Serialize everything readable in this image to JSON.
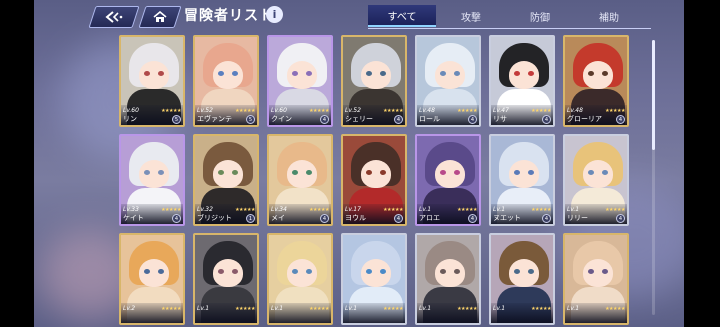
{
  "header": {
    "title": "冒険者リスト",
    "info_label": "i",
    "back_icon": "back-arrow-icon",
    "home_icon": "home-icon"
  },
  "tabs": [
    {
      "label": "すべて",
      "active": true
    },
    {
      "label": "攻撃",
      "active": false
    },
    {
      "label": "防御",
      "active": false
    },
    {
      "label": "補助",
      "active": false
    }
  ],
  "colors": {
    "gold_frame": "#d8b66a",
    "silver_frame": "#c9cedf",
    "purple_frame": "#b996e8",
    "tab_active": "#1c225a",
    "star": "#ffd66b"
  },
  "rows": [
    [
      {
        "level": "Lv.60",
        "name": "リン",
        "stars": "★★★★★",
        "rank": "5",
        "frame": "gold",
        "hair": "#e8e6ea",
        "bg": "#c9c4b8",
        "eyes": "#b04a4a",
        "outfit": "#2a2a2a"
      },
      {
        "level": "Lv.52",
        "name": "エヴァンテ",
        "stars": "★★★★★",
        "rank": "5",
        "frame": "gold",
        "hair": "#e8a78e",
        "bg": "#e7b9a2",
        "eyes": "#5a7fbf",
        "outfit": "#f0d6c0"
      },
      {
        "level": "Lv.60",
        "name": "クイン",
        "stars": "★★★★★",
        "rank": "4",
        "frame": "purple",
        "hair": "#f0f0f4",
        "bg": "#bba9da",
        "eyes": "#8a6fb8",
        "outfit": "#d9d9e4"
      },
      {
        "level": "Lv.52",
        "name": "シェリー",
        "stars": "★★★★★",
        "rank": "4",
        "frame": "gold",
        "hair": "#cfd2da",
        "bg": "#7f7a70",
        "eyes": "#4a6a8a",
        "outfit": "#3b3531"
      },
      {
        "level": "Lv.48",
        "name": "ロール",
        "stars": "★★★★★",
        "rank": "4",
        "frame": "silver",
        "hair": "#e6edf5",
        "bg": "#b7c7db",
        "eyes": "#6a8ab8",
        "outfit": "#d8e2ee"
      },
      {
        "level": "Lv.47",
        "name": "リサ",
        "stars": "★★★★★",
        "rank": "4",
        "frame": "silver",
        "hair": "#232326",
        "bg": "#c6cad8",
        "eyes": "#c43b3b",
        "outfit": "#ffffff"
      },
      {
        "level": "Lv.48",
        "name": "グローリア",
        "stars": "★★★★★",
        "rank": "4",
        "frame": "gold",
        "hair": "#c43a2c",
        "bg": "#b98a5a",
        "eyes": "#5a3a2a",
        "outfit": "#3b2a2a"
      }
    ],
    [
      {
        "level": "Lv.33",
        "name": "ケイト",
        "stars": "★★★★★",
        "rank": "4",
        "frame": "purple",
        "hair": "#e8eaf0",
        "bg": "#b79ed6",
        "eyes": "#7a90b8",
        "outfit": "#f4f4f8"
      },
      {
        "level": "Lv.32",
        "name": "ブリジット",
        "stars": "★★★★★",
        "rank": "1",
        "frame": "gold",
        "hair": "#7a5a3e",
        "bg": "#c9b089",
        "eyes": "#6a8a5a",
        "outfit": "#2e2a2a"
      },
      {
        "level": "Lv.34",
        "name": "メイ",
        "stars": "★★★★★",
        "rank": "4",
        "frame": "gold",
        "hair": "#e8b98a",
        "bg": "#e3c89c",
        "eyes": "#4a8a6a",
        "outfit": "#f2e2c8"
      },
      {
        "level": "Lv.17",
        "name": "ヨウル",
        "stars": "★★★★★",
        "rank": "4",
        "frame": "gold",
        "hair": "#4a3028",
        "bg": "#9a4a3a",
        "eyes": "#8a3a2a",
        "outfit": "#b32a2a"
      },
      {
        "level": "Lv.1",
        "name": "アロエ",
        "stars": "★★★★★",
        "rank": "4",
        "frame": "purple",
        "hair": "#5a4a8a",
        "bg": "#7d6ab0",
        "eyes": "#b84a8a",
        "outfit": "#3a2e5a"
      },
      {
        "level": "Lv.1",
        "name": "ヌエット",
        "stars": "★★★★★",
        "rank": "4",
        "frame": "silver",
        "hair": "#d9e2f0",
        "bg": "#a9b8d6",
        "eyes": "#5a7ab8",
        "outfit": "#e8eef8"
      },
      {
        "level": "Lv.1",
        "name": "リリー",
        "stars": "★★★★★",
        "rank": "4",
        "frame": "silver",
        "hair": "#e8c37a",
        "bg": "#c8c4d0",
        "eyes": "#6a8ab8",
        "outfit": "#f4ead8"
      }
    ],
    [
      {
        "level": "Lv.2",
        "name": "",
        "stars": "★★★★★",
        "rank": "",
        "frame": "gold",
        "hair": "#e8a85a",
        "bg": "#e7c39a",
        "eyes": "#4a6a9a",
        "outfit": "#f2dcc0"
      },
      {
        "level": "Lv.1",
        "name": "",
        "stars": "★★★★★",
        "rank": "",
        "frame": "gold",
        "hair": "#2a2a30",
        "bg": "#6d6a70",
        "eyes": "#8a5a6a",
        "outfit": "#3a3a40"
      },
      {
        "level": "Lv.1",
        "name": "",
        "stars": "★★★★★",
        "rank": "",
        "frame": "gold",
        "hair": "#ecd59a",
        "bg": "#e6cfa0",
        "eyes": "#5a8aba",
        "outfit": "#f0e0c0"
      },
      {
        "level": "Lv.1",
        "name": "",
        "stars": "★★★★★",
        "rank": "",
        "frame": "silver",
        "hair": "#c9d6ec",
        "bg": "#b4c6e2",
        "eyes": "#4a8ac8",
        "outfit": "#e2ecf8"
      },
      {
        "level": "Lv.1",
        "name": "",
        "stars": "★★★★★",
        "rank": "",
        "frame": "silver",
        "hair": "#9a8a84",
        "bg": "#b0a8a8",
        "eyes": "#6a5a5a",
        "outfit": "#3a3a44"
      },
      {
        "level": "Lv.1",
        "name": "",
        "stars": "★★★★★",
        "rank": "",
        "frame": "silver",
        "hair": "#7a5a3a",
        "bg": "#b6a6b8",
        "eyes": "#4a6a8a",
        "outfit": "#2e3a5a"
      },
      {
        "level": "Lv.1",
        "name": "",
        "stars": "★★★★★",
        "rank": "",
        "frame": "gold",
        "hair": "#e8c8a8",
        "bg": "#d8b898",
        "eyes": "#6a5a8a",
        "outfit": "#f0dcc8"
      }
    ]
  ]
}
